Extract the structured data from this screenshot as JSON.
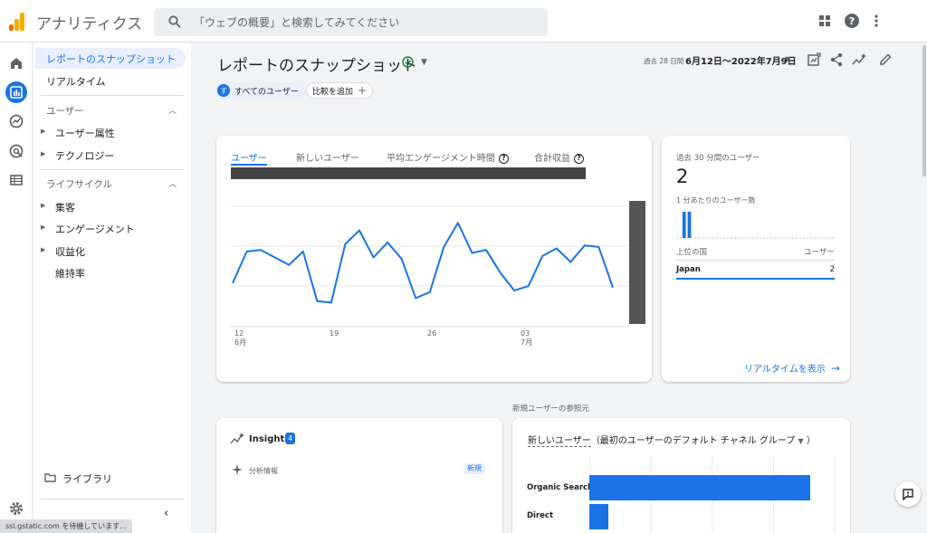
{
  "app": {
    "title": "アナリティクス"
  },
  "search": {
    "placeholder": "「ウェブの概要」と検索してみてください"
  },
  "colors": {
    "accent": "#1a73e8",
    "logo_orange": "#f9ab00",
    "logo_dark_orange": "#e37400"
  },
  "icons": {
    "top": [
      "apps-icon",
      "help-icon",
      "more-vert-icon"
    ],
    "rail": [
      "home-icon",
      "reports-icon",
      "explore-icon",
      "advertising-icon",
      "configure-icon",
      "settings-icon"
    ]
  },
  "nav": {
    "snapshot": "レポートのスナップショット",
    "realtime": "リアルタイム",
    "user_section": "ユーザー",
    "user_items": [
      "ユーザー属性",
      "テクノロジー"
    ],
    "lifecycle_section": "ライフサイクル",
    "lifecycle_items": [
      "集客",
      "エンゲージメント",
      "収益化"
    ],
    "retention": "維持率",
    "library": "ライブラリ"
  },
  "header": {
    "title": "レポートのスナップショット",
    "date_label": "過去 28 日間",
    "date_range": "6月12日～2022年7月9日"
  },
  "chips": {
    "all_users": "すべてのユーザー",
    "all_users_avatar": "す",
    "add_compare": "比較を追加"
  },
  "overview": {
    "tabs": [
      "ユーザー",
      "新しいユーザー",
      "平均エンゲージメント時間",
      "合計収益"
    ],
    "help_glyph": "?",
    "x_ticks": [
      {
        "day": "12",
        "month": "6月"
      },
      {
        "day": "19",
        "month": ""
      },
      {
        "day": "26",
        "month": ""
      },
      {
        "day": "03",
        "month": "7月"
      }
    ],
    "series": [
      29,
      50,
      51,
      46,
      41,
      50,
      17,
      16,
      55,
      64,
      46,
      56,
      45,
      19,
      23,
      53,
      69,
      49,
      51,
      36,
      24,
      27,
      47,
      52,
      43,
      54,
      53,
      26
    ]
  },
  "realtime": {
    "title": "過去 30 分間のユーザー",
    "value": "2",
    "per_minute_label": "1 分あたりのユーザー数",
    "per_minute_bars": [
      0,
      0,
      0,
      0,
      0,
      0,
      0,
      0,
      0,
      0,
      0,
      0,
      0,
      0,
      0,
      0,
      0,
      0,
      0,
      0,
      0,
      0,
      0,
      0,
      0,
      0,
      0,
      1,
      1,
      0
    ],
    "col_country": "上位の国",
    "col_users": "ユーザー",
    "rows": [
      {
        "country": "Japan",
        "users": "2"
      }
    ],
    "view_link": "リアルタイムを表示"
  },
  "insights": {
    "caption": "新規ユーザーの参照元",
    "title": "Insights",
    "count": "4",
    "item": "分析情報",
    "new_badge": "新規"
  },
  "acquisition": {
    "metric": "新しいユーザー",
    "dimension": "（最初のユーザーのデフォルト チャネル グループ",
    "close_paren": "）",
    "channels": [
      "Organic Search",
      "Direct"
    ],
    "values": [
      100,
      8.5
    ]
  },
  "status_bar": "ssl.gstatic.com を待機しています..."
}
